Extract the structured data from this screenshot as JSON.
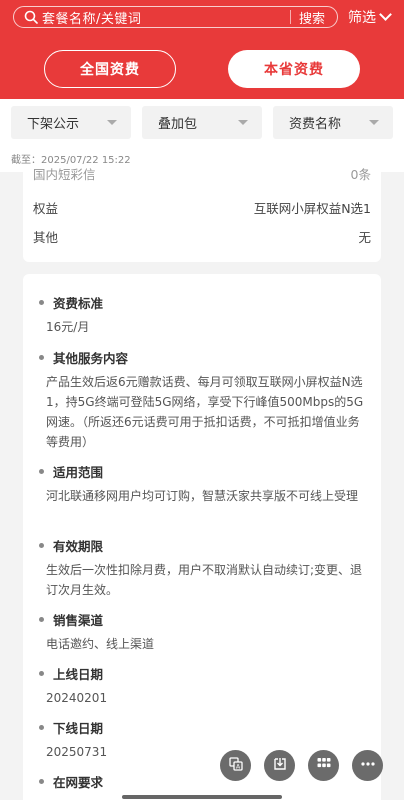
{
  "search": {
    "placeholder": "套餐名称/关键词",
    "button_label": "搜索"
  },
  "filter": {
    "label": "筛选"
  },
  "tabs": [
    {
      "label": "全国资费",
      "active": false
    },
    {
      "label": "本省资费",
      "active": true
    }
  ],
  "dropdowns": [
    {
      "label": "下架公示"
    },
    {
      "label": "叠加包"
    },
    {
      "label": "资费名称"
    }
  ],
  "timestamp": "截至：2025/07/22 15:22",
  "card1": {
    "partial_row": {
      "key": "国内短彩信",
      "value": "0条"
    },
    "rows": [
      {
        "key": "权益",
        "value": "互联网小屏权益N选1"
      },
      {
        "key": "其他",
        "value": "无"
      }
    ]
  },
  "sections": [
    {
      "title": "资费标准",
      "body": "16元/月"
    },
    {
      "title": "其他服务内容",
      "body": "产品生效后返6元赠款话费、每月可领取互联网小屏权益N选1，持5G终端可登陆5G网络，享受下行峰值500Mbps的5G网速。（所返还6元话费可用于抵扣话费，不可抵扣增值业务等费用）"
    },
    {
      "title": "适用范围",
      "body": "河北联通移网用户均可订购，智慧沃家共享版不可线上受理"
    },
    {
      "title": "有效期限",
      "body": "生效后一次性扣除月费，用户不取消默认自动续订;变更、退订次月生效。"
    },
    {
      "title": "销售渠道",
      "body": "电话邀约、线上渠道"
    },
    {
      "title": "上线日期",
      "body": "20240201"
    },
    {
      "title": "下线日期",
      "body": "20250731"
    },
    {
      "title": "在网要求",
      "body": ""
    }
  ],
  "colors": {
    "brand_red": "#e83a3a",
    "fab_gray": "#6b6b6b"
  },
  "fab_icons": [
    "translate-icon",
    "download-icon",
    "grid-icon",
    "more-icon"
  ]
}
